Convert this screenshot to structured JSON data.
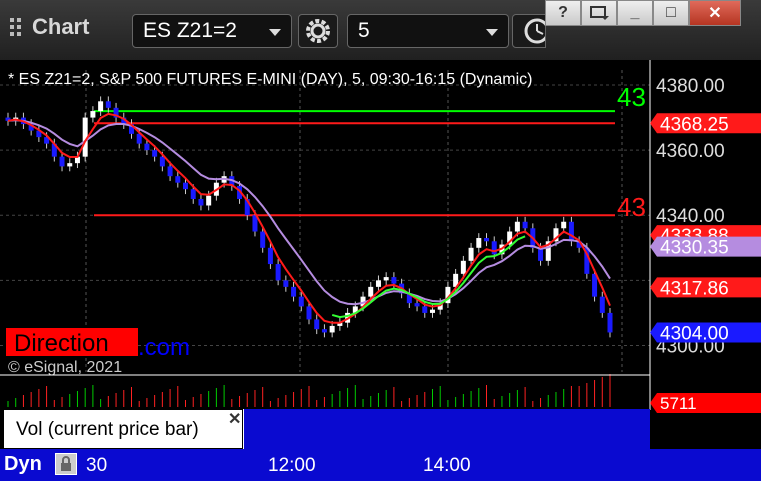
{
  "app": {
    "title": "Chart"
  },
  "toolbar": {
    "symbol": "ES Z21=2",
    "interval": "5"
  },
  "window": {
    "help": "?",
    "minimize": "_",
    "maximize": "□",
    "close": "✕"
  },
  "chart": {
    "info": "* ES Z21=2, S&P 500 FUTURES E-MINI (DAY), 5, 09:30-16:15 (Dynamic)",
    "direction_label": "Direction",
    "direction_suffix": ".com",
    "copyright": "© eSignal, 2021",
    "price_axis": [
      "4380.00",
      "4360.00",
      "4340.00",
      "4300.00"
    ],
    "price_tags": [
      {
        "value": "4368.25",
        "color": "#ff1a1a"
      },
      {
        "value": "4333.88",
        "color": "#ff1a1a"
      },
      {
        "value": "4330.35",
        "color": "#b58ce0"
      },
      {
        "value": "4317.86",
        "color": "#ff1a1a"
      },
      {
        "value": "4304.00",
        "color": "#1a1aff"
      }
    ],
    "line_labels": [
      {
        "text": "43",
        "color": "#00ff00"
      },
      {
        "text": "43",
        "color": "#ff1a1a"
      }
    ],
    "volume_tag": "5711",
    "volume_label": "Vol (current price bar)",
    "time_axis": [
      "30",
      "12:00",
      "14:00"
    ],
    "mode": "Dyn"
  },
  "chart_data": {
    "type": "candlestick",
    "symbol": "ES Z21=2",
    "interval": "5",
    "ylim": [
      4294,
      4384
    ],
    "time_ticks": [
      "30",
      "12:00",
      "14:00"
    ],
    "closes": [
      4369,
      4370,
      4368,
      4366,
      4364,
      4362,
      4358,
      4355,
      4356,
      4358,
      4370,
      4372,
      4375,
      4373,
      4370,
      4368,
      4365,
      4362,
      4360,
      4358,
      4355,
      4352,
      4350,
      4348,
      4345,
      4343,
      4346,
      4350,
      4352,
      4349,
      4345,
      4340,
      4335,
      4330,
      4325,
      4320,
      4318,
      4315,
      4312,
      4308,
      4305,
      4304,
      4306,
      4307,
      4310,
      4312,
      4315,
      4318,
      4320,
      4321,
      4319,
      4316,
      4313,
      4312,
      4310,
      4311,
      4313,
      4318,
      4322,
      4326,
      4330,
      4333,
      4332,
      4328,
      4331,
      4335,
      4338,
      4336,
      4330,
      4326,
      4332,
      4336,
      4338,
      4332,
      4330,
      4322,
      4315,
      4310,
      4304
    ],
    "series": [
      {
        "name": "green",
        "color": "#33ff33"
      },
      {
        "name": "red",
        "color": "#ff1a1a"
      },
      {
        "name": "purple",
        "color": "#b58ce0"
      }
    ],
    "horizontal_lines": [
      {
        "value": 4372,
        "color": "#00ff00"
      },
      {
        "value": 4368.25,
        "color": "#ff1a1a"
      },
      {
        "value": 4340,
        "color": "#ff1a1a"
      }
    ],
    "volume_last": 5711
  }
}
